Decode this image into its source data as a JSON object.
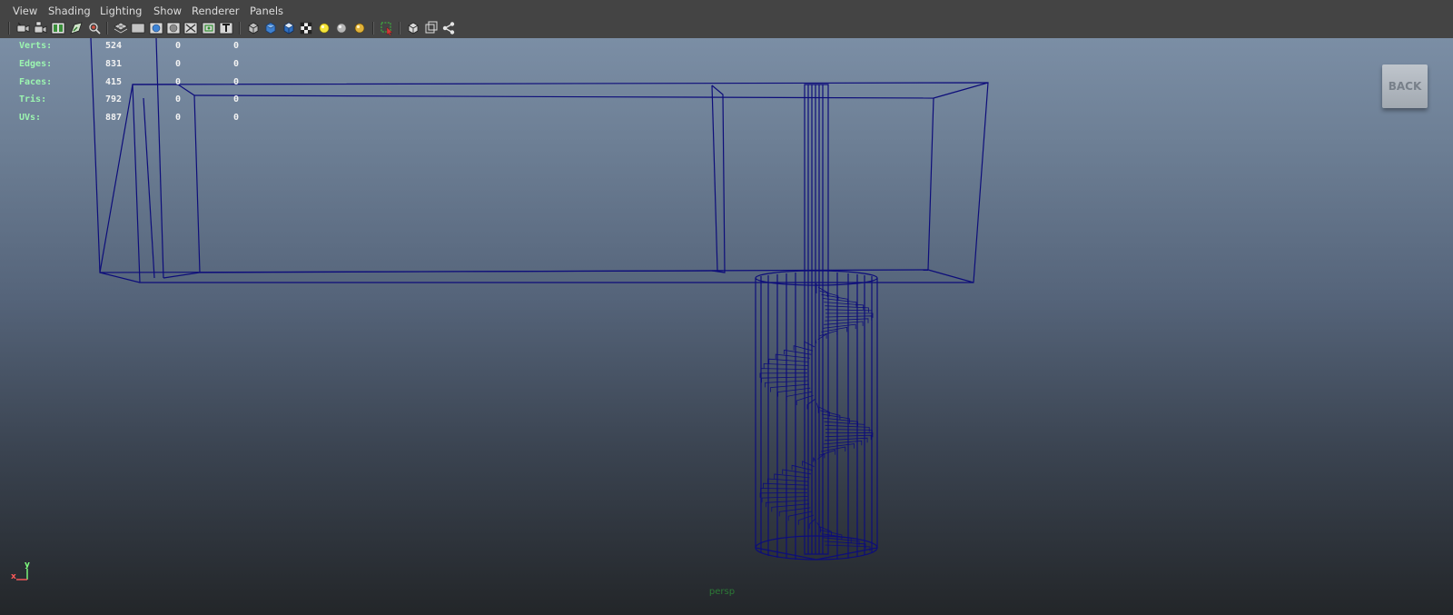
{
  "menu": {
    "items": [
      {
        "label": "View"
      },
      {
        "label": "Shading"
      },
      {
        "label": "Lighting"
      },
      {
        "label": "Show"
      },
      {
        "label": "Renderer"
      },
      {
        "label": "Panels"
      }
    ]
  },
  "toolbar": {
    "icons": [
      "select-camera-icon",
      "lock-camera-icon",
      "camera-attributes-icon",
      "bookmark-icon",
      "image-plane-icon",
      "grid-icon",
      "film-gate-icon",
      "resolution-gate-icon",
      "gate-mask-icon",
      "field-chart-icon",
      "safe-title-icon",
      "wireframe-icon",
      "smooth-shade-icon",
      "flat-shade-icon",
      "checker-icon",
      "default-light-icon",
      "all-lights-icon",
      "shadows-icon",
      "isolate-select-icon",
      "xray-icon",
      "xray-joints-icon",
      "node-editor-icon"
    ]
  },
  "hud": {
    "rows": [
      {
        "label": "Verts:",
        "v1": "524",
        "v2": "0",
        "v3": "0"
      },
      {
        "label": "Edges:",
        "v1": "831",
        "v2": "0",
        "v3": "0"
      },
      {
        "label": "Faces:",
        "v1": "415",
        "v2": "0",
        "v3": "0"
      },
      {
        "label": "Tris:",
        "v1": "792",
        "v2": "0",
        "v3": "0"
      },
      {
        "label": "UVs:",
        "v1": "887",
        "v2": "0",
        "v3": "0"
      }
    ]
  },
  "back_button": {
    "label": "BACK"
  },
  "axis": {
    "x_label": "x",
    "y_label": "y"
  },
  "camera": {
    "name": "persp"
  },
  "colors": {
    "wireframe": "#0d0d7a",
    "hud_label": "#9cf5b0",
    "hud_value": "#f2f2f2",
    "menu_bg": "#444444",
    "viewport_top": "#7b8ea5",
    "viewport_bottom": "#232629"
  }
}
